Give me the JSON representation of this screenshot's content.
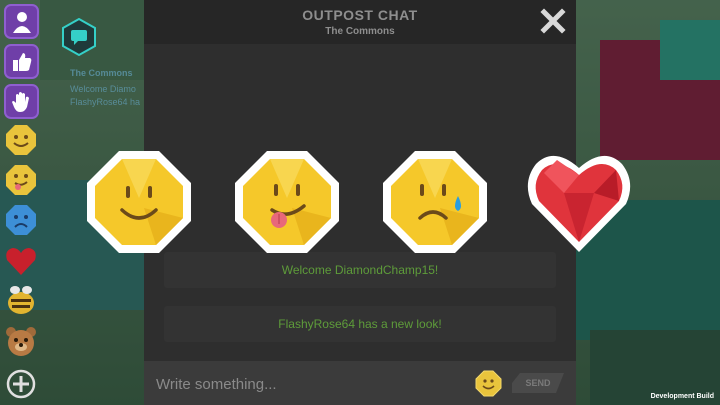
{
  "chat": {
    "title": "OUTPOST CHAT",
    "subtitle": "The Commons",
    "messages": [
      {
        "text": "Welcome DiamondChamp15!"
      },
      {
        "text": "FlashyRose64 has a new look!"
      }
    ],
    "compose_placeholder": "Write something...",
    "send_label": "SEND"
  },
  "left_panel": {
    "channel": "The Commons",
    "line1": "Welcome Diamo",
    "line2": "FlashyRose64 ha"
  },
  "reactions": [
    {
      "icon": "smiley-face-icon"
    },
    {
      "icon": "tongue-out-face-icon"
    },
    {
      "icon": "sad-tear-face-icon"
    },
    {
      "icon": "heart-icon"
    }
  ],
  "dock": [
    "profile-icon",
    "thumbs-up-icon",
    "wave-hand-icon",
    "smiley-face-icon",
    "tongue-out-face-icon",
    "sad-face-icon",
    "heart-icon",
    "bee-icon",
    "bear-icon",
    "add-icon"
  ],
  "colors": {
    "panel_bg": "#2e2e2e",
    "message_green": "#5e9c3a",
    "emoji_yellow": "#f5c82a",
    "heart_red": "#e0343c"
  },
  "footer": {
    "dev_build": "Development Build"
  }
}
